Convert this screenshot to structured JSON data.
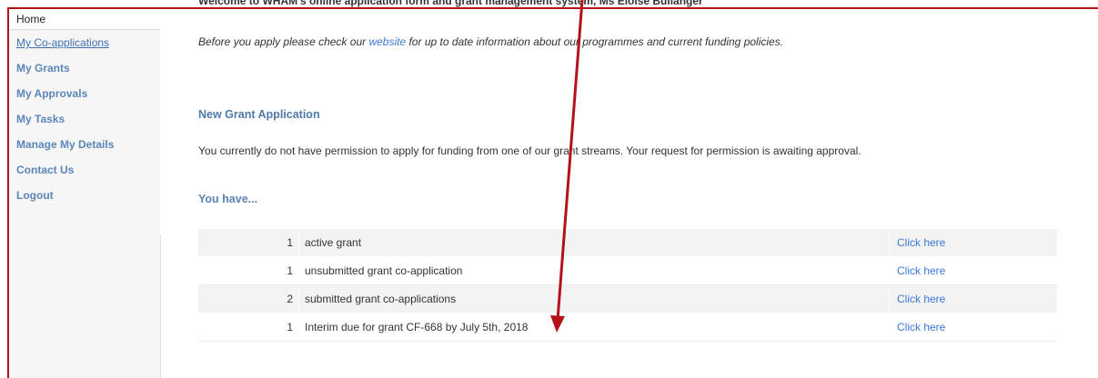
{
  "sidebar": {
    "home": "Home",
    "items": [
      {
        "label": "My Co-applications"
      },
      {
        "label": "My Grants"
      },
      {
        "label": "My Approvals"
      },
      {
        "label": "My Tasks"
      },
      {
        "label": "Manage My Details"
      },
      {
        "label": "Contact Us"
      },
      {
        "label": "Logout"
      }
    ]
  },
  "main": {
    "welcome": "Welcome to WHAM's online application form and grant management system, Ms Eloise Bullanger",
    "intro_before": "Before you apply please check our ",
    "intro_link": "website",
    "intro_after": " for up to date information about our programmes and current funding policies.",
    "new_grant_heading": "New Grant Application",
    "permission_text": "You currently do not have permission to apply for funding from one of our grant streams. Your request for permission is awaiting approval.",
    "you_have_heading": "You have...",
    "rows": [
      {
        "count": "1",
        "description": "active grant",
        "action": "Click here"
      },
      {
        "count": "1",
        "description": "unsubmitted grant co-application",
        "action": "Click here"
      },
      {
        "count": "2",
        "description": "submitted grant co-applications",
        "action": "Click here"
      },
      {
        "count": "1",
        "description": "Interim due for grant CF-668 by July 5th, 2018",
        "action": "Click here"
      }
    ]
  },
  "colors": {
    "annotation": "#b3121b",
    "nav_link": "#5a86b8",
    "link": "#3d78d8"
  }
}
